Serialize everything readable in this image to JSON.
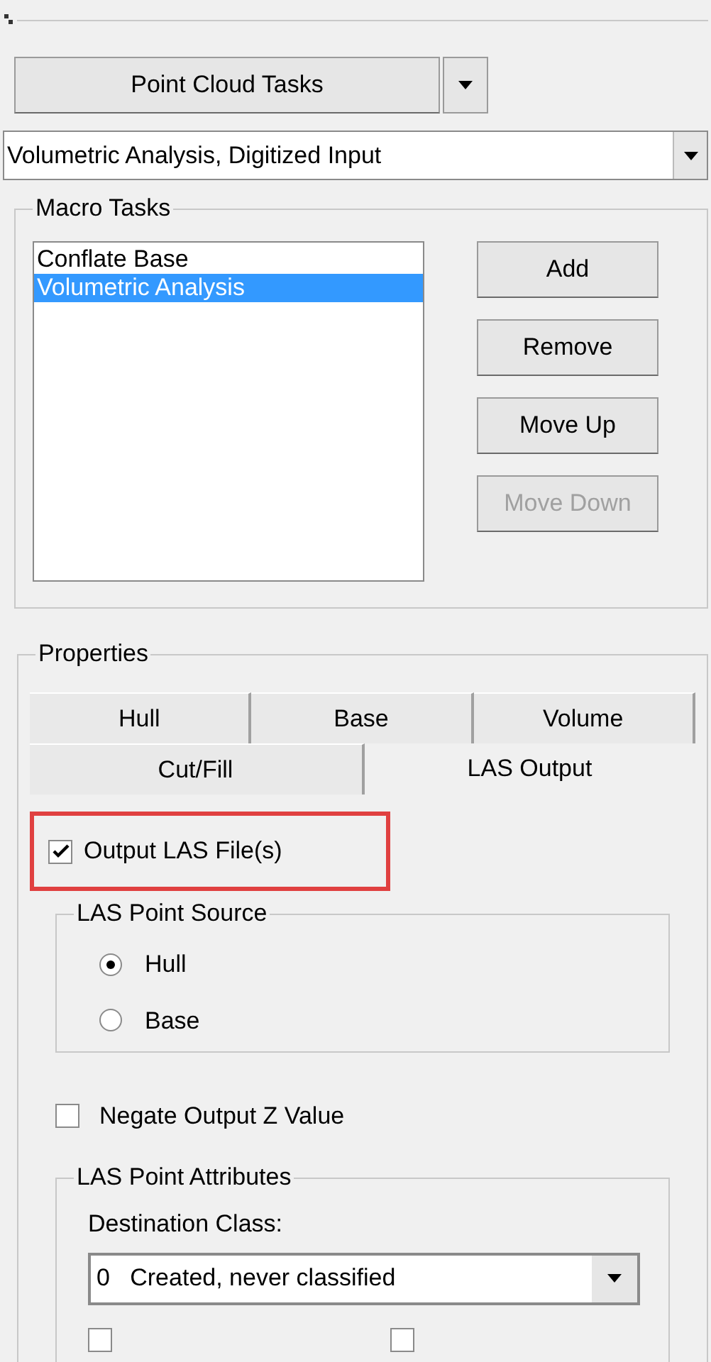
{
  "task_button": {
    "label": "Point Cloud Tasks"
  },
  "task_combo": {
    "value": "Volumetric Analysis, Digitized Input"
  },
  "macro_tasks": {
    "title": "Macro Tasks",
    "items": [
      {
        "label": "Conflate Base",
        "selected": false
      },
      {
        "label": "Volumetric Analysis",
        "selected": true
      }
    ],
    "buttons": [
      {
        "label": "Add",
        "disabled": false
      },
      {
        "label": "Remove",
        "disabled": false
      },
      {
        "label": "Move Up",
        "disabled": false
      },
      {
        "label": "Move Down",
        "disabled": true
      }
    ]
  },
  "properties": {
    "title": "Properties",
    "tab_rows": [
      [
        {
          "label": "Hull",
          "selected": false
        },
        {
          "label": "Base",
          "selected": false
        },
        {
          "label": "Volume",
          "selected": false
        }
      ],
      [
        {
          "label": "Cut/Fill",
          "selected": false
        },
        {
          "label": "LAS Output",
          "selected": true
        }
      ]
    ],
    "output_las": {
      "label": "Output LAS File(s)",
      "checked": true,
      "highlighted": true
    },
    "point_source": {
      "title": "LAS Point Source",
      "options": [
        {
          "label": "Hull",
          "selected": true
        },
        {
          "label": "Base",
          "selected": false
        }
      ]
    },
    "negate_z": {
      "label": "Negate Output Z Value",
      "checked": false
    },
    "attributes": {
      "title": "LAS Point Attributes",
      "destination_label": "Destination Class:",
      "destination_value": "0   Created, never classified",
      "flags": [
        {
          "checked": false
        },
        {
          "checked": false
        }
      ]
    }
  }
}
